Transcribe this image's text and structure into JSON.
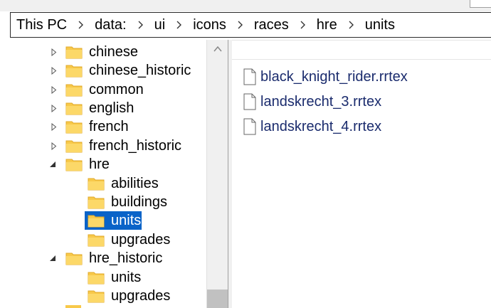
{
  "address_bar": {
    "breadcrumbs": [
      "This PC",
      "data:",
      "ui",
      "icons",
      "races",
      "hre",
      "units"
    ]
  },
  "navigation_tree": {
    "items": [
      {
        "label": "chinese",
        "expanded": false,
        "selected": false
      },
      {
        "label": "chinese_historic",
        "expanded": false,
        "selected": false
      },
      {
        "label": "common",
        "expanded": false,
        "selected": false
      },
      {
        "label": "english",
        "expanded": false,
        "selected": false
      },
      {
        "label": "french",
        "expanded": false,
        "selected": false
      },
      {
        "label": "french_historic",
        "expanded": false,
        "selected": false
      },
      {
        "label": "hre",
        "expanded": true,
        "selected": false
      },
      {
        "label": "abilities",
        "expanded": null,
        "selected": false
      },
      {
        "label": "buildings",
        "expanded": null,
        "selected": false
      },
      {
        "label": "units",
        "expanded": null,
        "selected": true
      },
      {
        "label": "upgrades",
        "expanded": null,
        "selected": false
      },
      {
        "label": "hre_historic",
        "expanded": true,
        "selected": false
      },
      {
        "label": "units",
        "expanded": null,
        "selected": false
      },
      {
        "label": "upgrades",
        "expanded": null,
        "selected": false
      }
    ]
  },
  "file_list": {
    "files": [
      {
        "name": "black_knight_rider.rrtex",
        "icon": "file-icon"
      },
      {
        "name": "landskrecht_3.rrtex",
        "icon": "file-icon"
      },
      {
        "name": "landskrecht_4.rrtex",
        "icon": "file-icon"
      }
    ]
  },
  "colors": {
    "selection": "#0a63c8",
    "folder": "#f8c94a",
    "file_text": "#1a2b6d"
  }
}
